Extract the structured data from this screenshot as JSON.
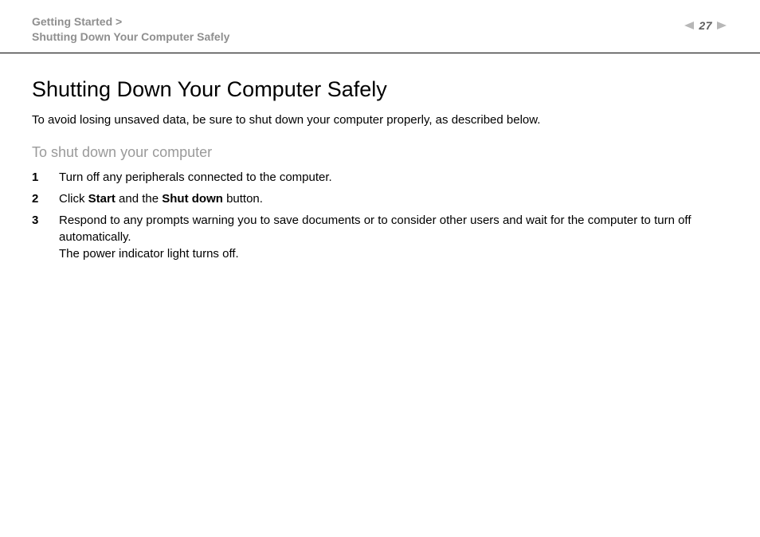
{
  "header": {
    "breadcrumb_parent": "Getting Started >",
    "breadcrumb_current": "Shutting Down Your Computer Safely",
    "page_number": "27"
  },
  "content": {
    "title": "Shutting Down Your Computer Safely",
    "intro": "To avoid losing unsaved data, be sure to shut down your computer properly, as described below.",
    "section_heading": "To shut down your computer",
    "steps": [
      {
        "n": "1",
        "text": "Turn off any peripherals connected to the computer."
      },
      {
        "n": "2",
        "text_pre": "Click ",
        "bold1": "Start",
        "text_mid": " and the ",
        "bold2": "Shut down",
        "text_post": " button."
      },
      {
        "n": "3",
        "text": "Respond to any prompts warning you to save documents or to consider other users and wait for the computer to turn off automatically.",
        "text2": "The power indicator light turns off."
      }
    ]
  }
}
